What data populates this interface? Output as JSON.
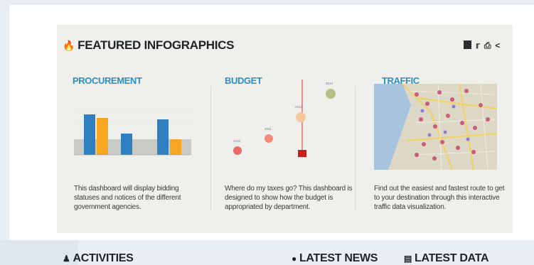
{
  "featured": {
    "icon": "flame-icon",
    "title": "FEATURED INFOGRAPHICS",
    "share_icons": [
      "facebook-icon",
      "twitter-icon",
      "print-icon",
      "share-icon"
    ]
  },
  "cards": [
    {
      "title": "PROCUREMENT",
      "description": "This dashboard will display bidding statuses and notices of the different government agencies."
    },
    {
      "title": "BUDGET",
      "description": "Where do my taxes go? This dashboard is designed to show how the budget is appropriated by department."
    },
    {
      "title": "TRAFFIC",
      "description": "Find out the easiest and fastest route to get to your destination through this interactive traffic data visualization."
    }
  ],
  "sections": {
    "activities": "ACTIVITIES",
    "latest_news": "LATEST NEWS",
    "latest_data": "LATEST DATA"
  },
  "budget_years": [
    "2010",
    "2011",
    "2012",
    "2013"
  ],
  "colors": {
    "accent": "#2a91c6",
    "bar_blue": "#2f7fc1",
    "bar_orange": "#f5a623",
    "panel": "#efefec"
  }
}
